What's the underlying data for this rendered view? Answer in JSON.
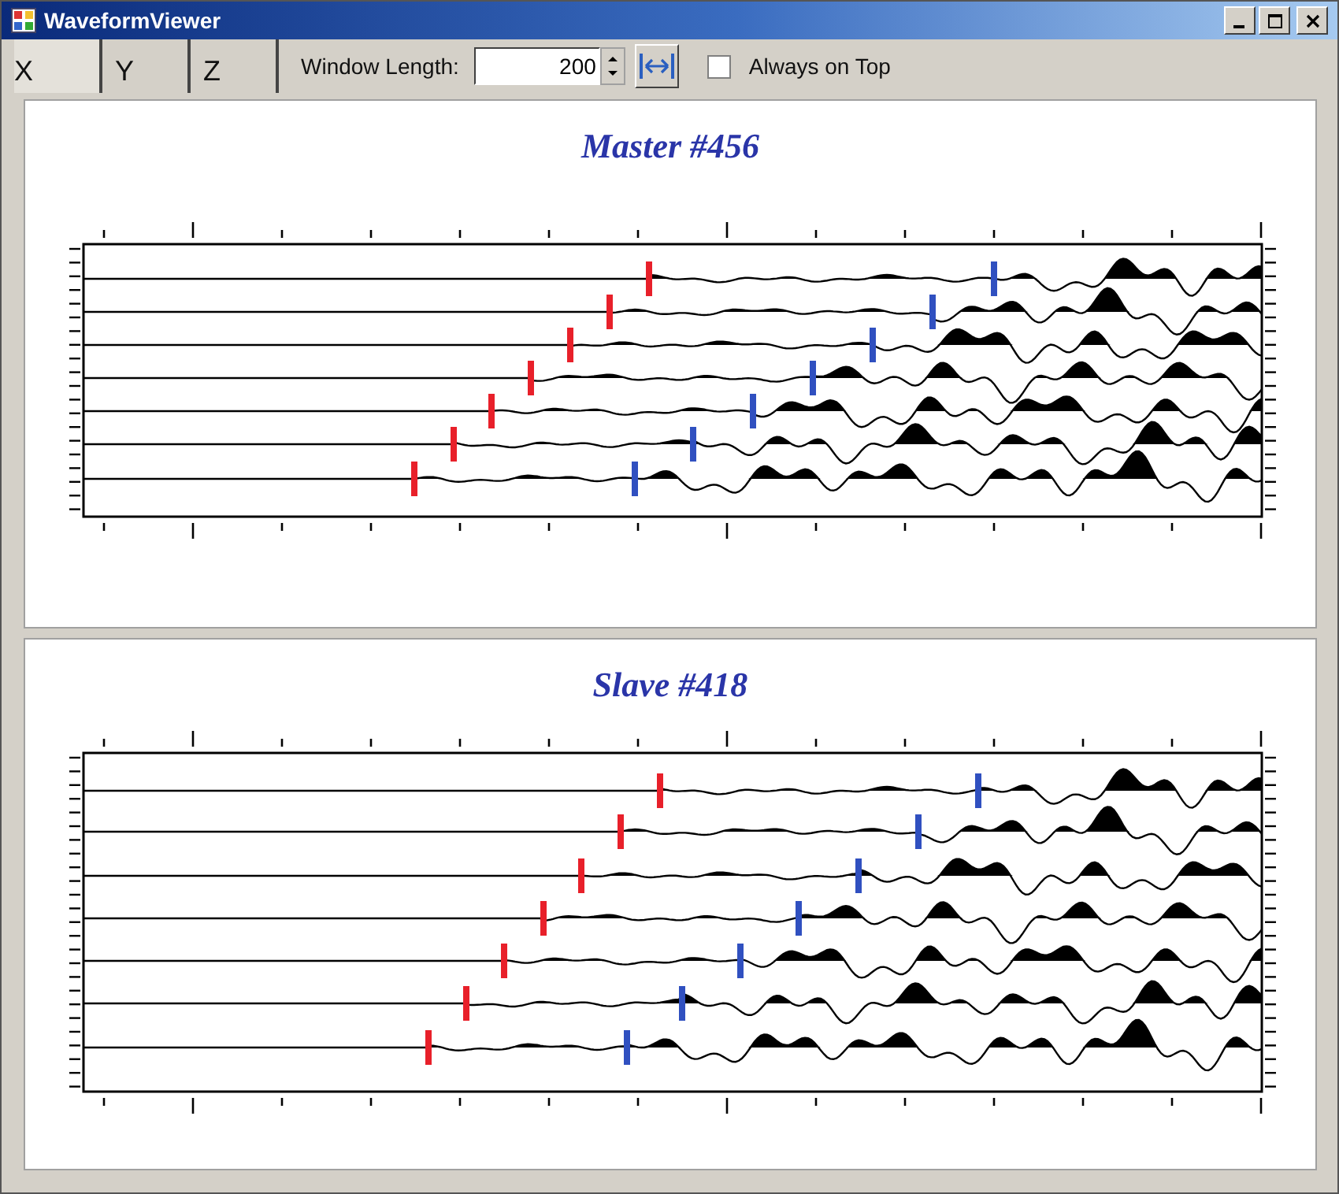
{
  "window": {
    "title": "WaveformViewer"
  },
  "tabs": [
    {
      "label": "X",
      "selected": true
    },
    {
      "label": "Y",
      "selected": false
    },
    {
      "label": "Z",
      "selected": false
    }
  ],
  "window_length": {
    "label": "Window Length:",
    "value": "200"
  },
  "always_on_top": {
    "label": "Always on Top",
    "checked": false
  },
  "panels": [
    {
      "title": "Master #456"
    },
    {
      "title": "Slave #418"
    }
  ]
}
